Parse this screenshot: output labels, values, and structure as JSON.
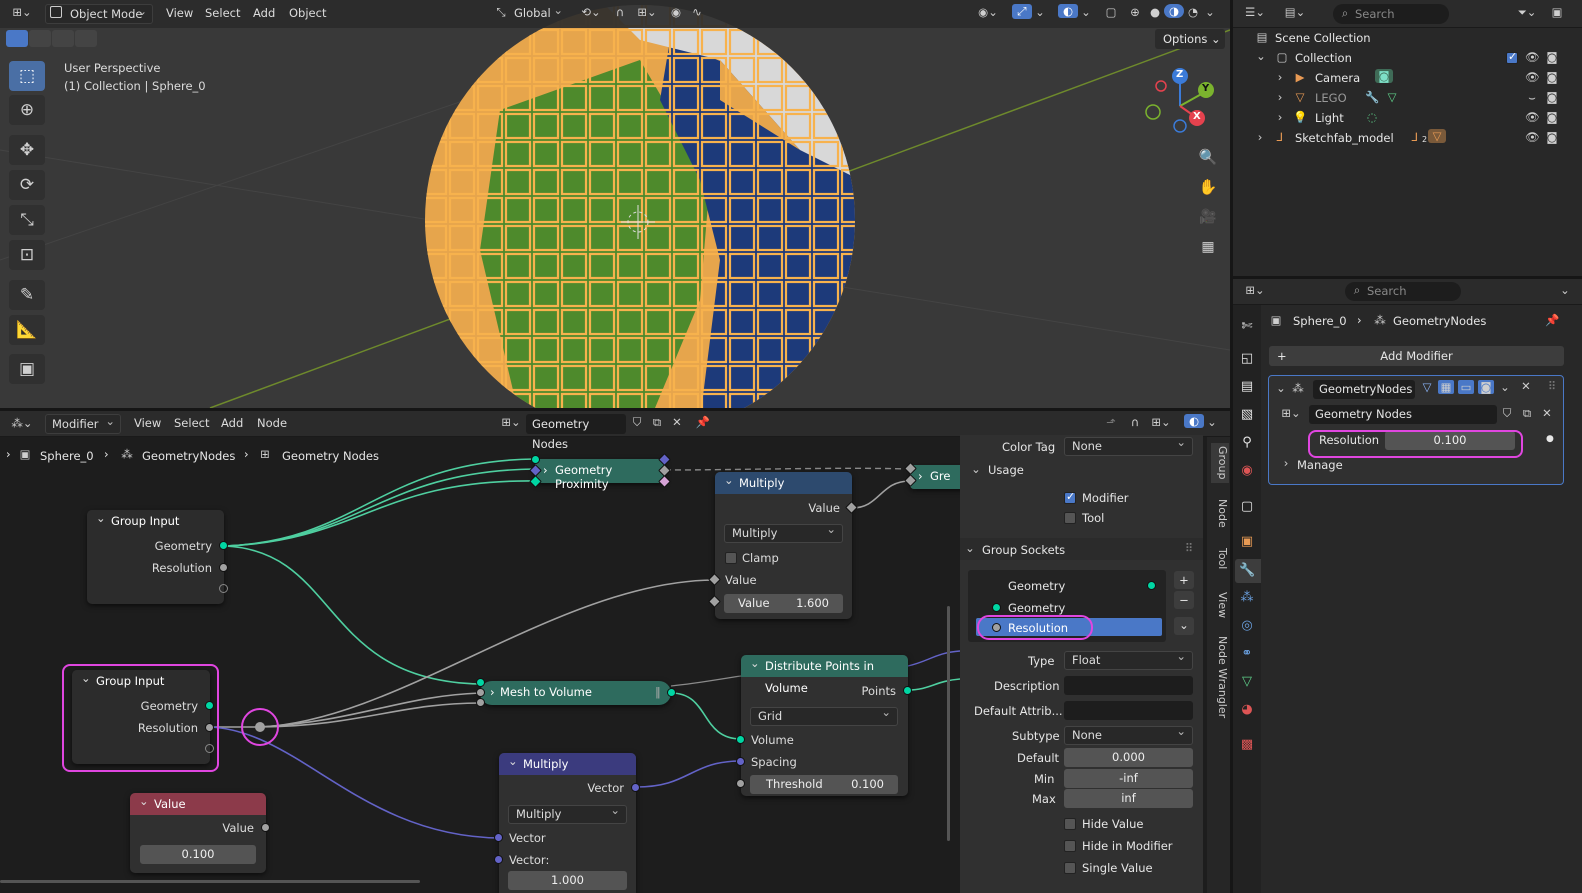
{
  "viewport": {
    "mode": "Object Mode",
    "menus": [
      "View",
      "Select",
      "Add",
      "Object"
    ],
    "orientation": "Global",
    "options": "Options",
    "info_line1": "User Perspective",
    "info_line2": "(1) Collection | Sphere_0",
    "axes": {
      "x": "X",
      "y": "Y",
      "z": "Z"
    }
  },
  "outliner": {
    "search_placeholder": "Search",
    "root": "Scene Collection",
    "items": [
      {
        "label": "Collection"
      },
      {
        "label": "Camera"
      },
      {
        "label": "LEGO"
      },
      {
        "label": "Light"
      },
      {
        "label": "Sketchfab_model",
        "badge": "2"
      }
    ]
  },
  "properties": {
    "search_placeholder": "Search",
    "breadcrumb_object": "Sphere_0",
    "breadcrumb_modifier": "GeometryNodes",
    "add_modifier": "Add Modifier",
    "modifier_name": "GeometryNodes",
    "node_group": "Geometry Nodes",
    "resolution_label": "Resolution",
    "resolution_value": "0.100",
    "manage": "Manage"
  },
  "node_editor": {
    "editor_type": "Modifier",
    "menus": [
      "View",
      "Select",
      "Add",
      "Node"
    ],
    "tree_name": "Geometry Nodes",
    "breadcrumb": [
      "Sphere_0",
      "GeometryNodes",
      "Geometry Nodes"
    ],
    "side_tabs": [
      "Group",
      "Node",
      "Tool",
      "View",
      "Node Wrangler"
    ]
  },
  "nodes": {
    "group_input_1": {
      "title": "Group Input",
      "out1": "Geometry",
      "out2": "Resolution"
    },
    "group_input_2": {
      "title": "Group Input",
      "out1": "Geometry",
      "out2": "Resolution"
    },
    "value": {
      "title": "Value",
      "out": "Value",
      "val": "0.100"
    },
    "geo_prox": {
      "title": "Geometry Proximity"
    },
    "geo_trunc": {
      "title": "Gre"
    },
    "multiply_top": {
      "title": "Multiply",
      "out": "Value",
      "op": "Multiply",
      "clamp": "Clamp",
      "in1": "Value",
      "in2_label": "Value",
      "in2_val": "1.600"
    },
    "mesh_to_volume": {
      "title": "Mesh to Volume"
    },
    "multiply_vec": {
      "title": "Multiply",
      "out": "Vector",
      "op": "Multiply",
      "in1": "Vector",
      "in2": "Vector:",
      "in2_val": "1.000"
    },
    "distribute": {
      "title": "Distribute Points in Volume",
      "out": "Points",
      "mode": "Grid",
      "in1": "Volume",
      "in2": "Spacing",
      "th_label": "Threshold",
      "th_val": "0.100"
    }
  },
  "group_panel": {
    "color_tag_label": "Color Tag",
    "color_tag_value": "None",
    "usage": "Usage",
    "modifier": "Modifier",
    "tool": "Tool",
    "group_sockets": "Group Sockets",
    "sockets": [
      "Geometry",
      "Geometry",
      "Resolution"
    ],
    "type_label": "Type",
    "type_value": "Float",
    "desc_label": "Description",
    "default_attr_label": "Default Attrib...",
    "subtype_label": "Subtype",
    "subtype_value": "None",
    "default_label": "Default",
    "default_value": "0.000",
    "min_label": "Min",
    "min_value": "-inf",
    "max_label": "Max",
    "max_value": "inf",
    "hide_value": "Hide Value",
    "hide_in_modifier": "Hide in Modifier",
    "single_value": "Single Value"
  },
  "colors": {
    "highlight": "#e046e0",
    "geometry_socket": "#00d6a3",
    "vector_socket": "#6363c7",
    "accent": "#4a78c7"
  }
}
